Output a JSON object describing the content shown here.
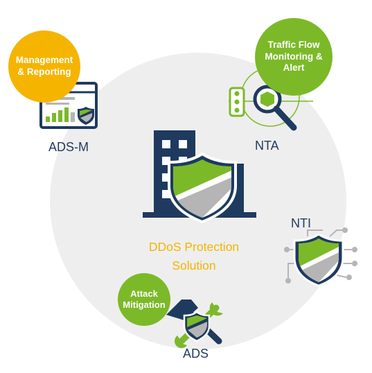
{
  "center": {
    "line1": "DDoS Protection",
    "line2": "Solution"
  },
  "nodes": {
    "adsm": {
      "label": "ADS-M",
      "bubble_lines": [
        "Management",
        "& Reporting"
      ]
    },
    "nta": {
      "label": "NTA",
      "bubble_lines": [
        "Traffic Flow",
        "Monitoring &",
        "Alert"
      ]
    },
    "nti": {
      "label": "NTI"
    },
    "ads": {
      "label": "ADS",
      "bubble_lines": [
        "Attack",
        "Mitigation"
      ]
    }
  },
  "colors": {
    "navy": "#1e3a5f",
    "green": "#7cb928",
    "yellow": "#f5b400",
    "circle_bg": "#eeeeee",
    "gray": "#b5b5b5"
  },
  "icons": {
    "center": "building-shield-icon",
    "adsm": "dashboard-shield-icon",
    "nta": "traffic-light-magnifier-icon",
    "nti": "circuit-shield-icon",
    "ads": "hammer-wrench-shield-icon"
  }
}
